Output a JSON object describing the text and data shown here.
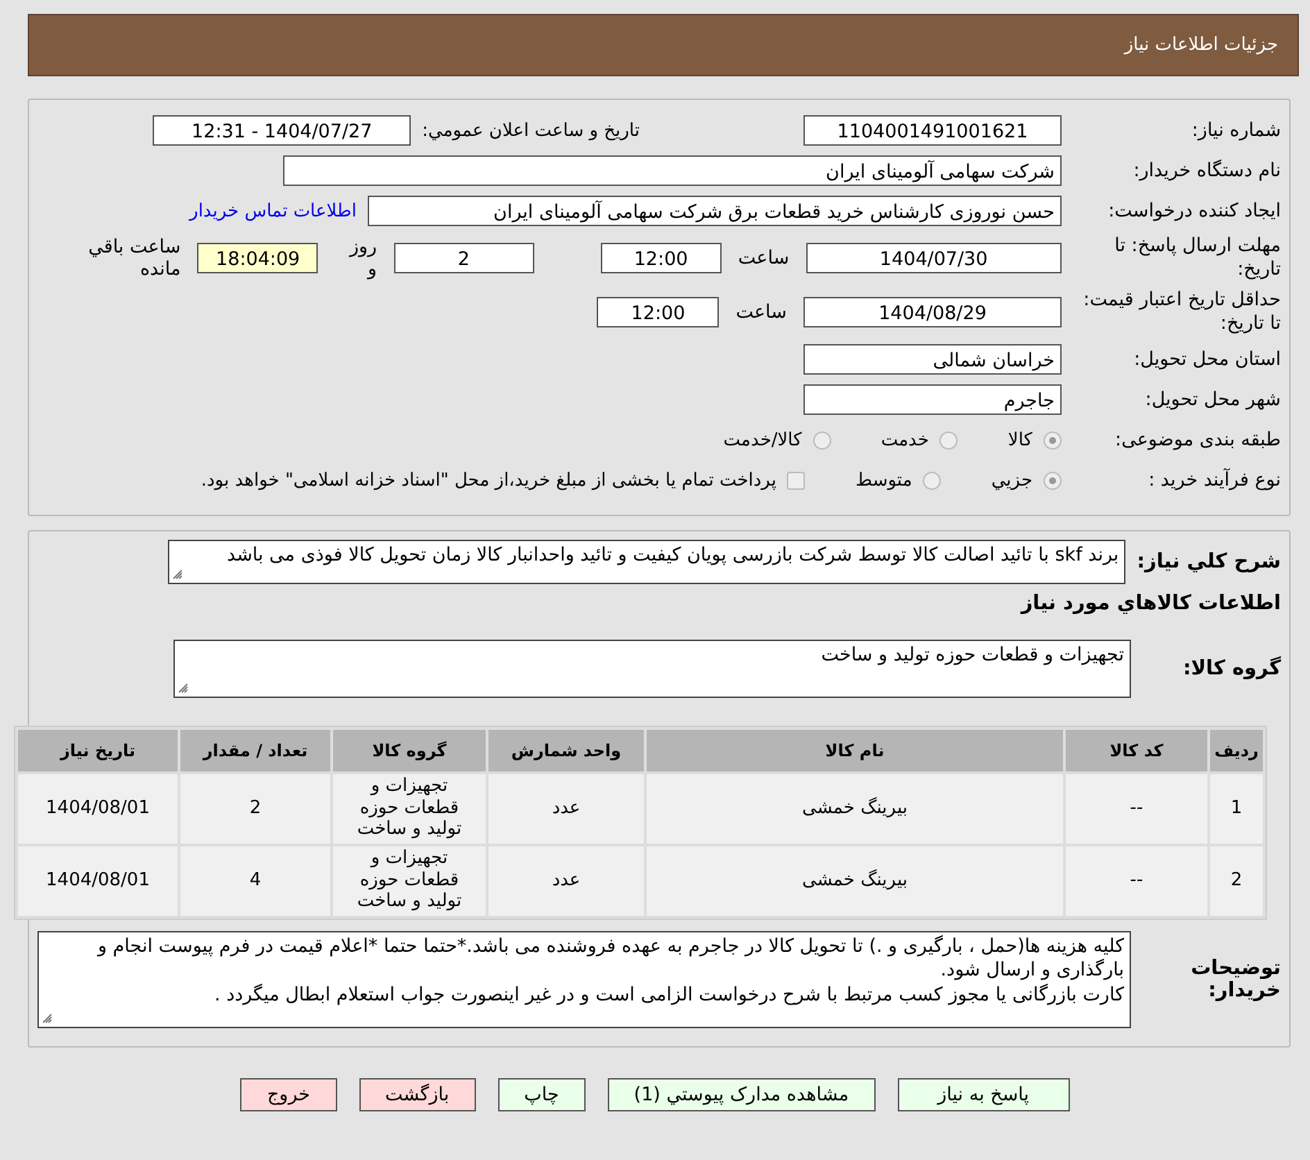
{
  "header": {
    "title": "جزئیات اطلاعات نیاز"
  },
  "need_number": {
    "label": "شماره نیاز:",
    "value": "1104001491001621"
  },
  "announce": {
    "label": "تاریخ و ساعت اعلان عمومي:",
    "value": "1404/07/27 - 12:31"
  },
  "buyer": {
    "label": "نام دستگاه خریدار:",
    "value": "شرکت سهامی آلومینای ایران"
  },
  "creator": {
    "label": "ایجاد کننده درخواست:",
    "value": "حسن نوروزی کارشناس خرید قطعات برق شرکت سهامی آلومینای ایران",
    "link": "اطلاعات تماس خریدار"
  },
  "reply_deadline": {
    "label": "مهلت ارسال پاسخ: تا تاریخ:",
    "date": "1404/07/30",
    "time_label": "ساعت",
    "time": "12:00",
    "days": "2",
    "days_label": "روز و",
    "remaining": "18:04:09",
    "remaining_label": "ساعت باقي مانده"
  },
  "price_validity": {
    "label": "حداقل تاریخ اعتبار قیمت: تا تاریخ:",
    "date": "1404/08/29",
    "time_label": "ساعت",
    "time": "12:00"
  },
  "province": {
    "label": "استان محل تحویل:",
    "value": "خراسان شمالی"
  },
  "city": {
    "label": "شهر محل تحویل:",
    "value": "جاجرم"
  },
  "category": {
    "label": "طبقه بندی موضوعی:",
    "options": [
      {
        "label": "کالا",
        "selected": true
      },
      {
        "label": "خدمت",
        "selected": false
      },
      {
        "label": "کالا/خدمت",
        "selected": false
      }
    ]
  },
  "process": {
    "label": "نوع فرآیند خرید :",
    "options": [
      {
        "label": "جزيي",
        "selected": true
      },
      {
        "label": "متوسط",
        "selected": false
      }
    ],
    "payment": {
      "checked": false,
      "text": "پرداخت تمام یا بخشی از مبلغ خرید،از محل \"اسناد خزانه اسلامی\" خواهد بود."
    }
  },
  "summary": {
    "label": "شرح کلي نياز:",
    "value": "برند skf با تائید اصالت کالا توسط شرکت بازرسی پویان کیفیت و تائید واحدانبار کالا زمان تحویل کالا فوذی می باشد"
  },
  "goods_title": "اطلاعات کالاهاي مورد نياز",
  "goods_group": {
    "label": "گروه کالا:",
    "value": "تجهیزات و قطعات حوزه تولید و ساخت"
  },
  "table": {
    "columns": [
      "ردیف",
      "کد کالا",
      "نام کالا",
      "واحد شمارش",
      "گروه کالا",
      "تعداد / مقدار",
      "تاریخ نیاز"
    ],
    "rows": [
      [
        "1",
        "--",
        "بیرینگ خمشی",
        "عدد",
        "تجهیزات و قطعات حوزه تولید و ساخت",
        "2",
        "1404/08/01"
      ],
      [
        "2",
        "--",
        "بیرینگ خمشی",
        "عدد",
        "تجهیزات و قطعات حوزه تولید و ساخت",
        "4",
        "1404/08/01"
      ]
    ]
  },
  "buyer_notes": {
    "label": "توضیحات خریدار:",
    "value": "کلیه هزینه ها(حمل ، بارگیری و .) تا تحویل کالا در جاجرم به عهده فروشنده می باشد.*حتما حتما *اعلام قیمت در فرم پیوست انجام و بارگذاری و ارسال شود.\nکارت بازرگانی یا مجوز کسب مرتبط با شرح درخواست الزامی است و در غیر اینصورت جواب استعلام ابطال میگردد ."
  },
  "buttons": [
    {
      "label": "پاسخ به نیاز",
      "kind": "primary"
    },
    {
      "label": "مشاهده مدارک پیوستي (1)",
      "kind": "primary"
    },
    {
      "label": "چاپ",
      "kind": "primary"
    },
    {
      "label": "بازگشت",
      "kind": "danger"
    },
    {
      "label": "خروج",
      "kind": "danger"
    }
  ]
}
